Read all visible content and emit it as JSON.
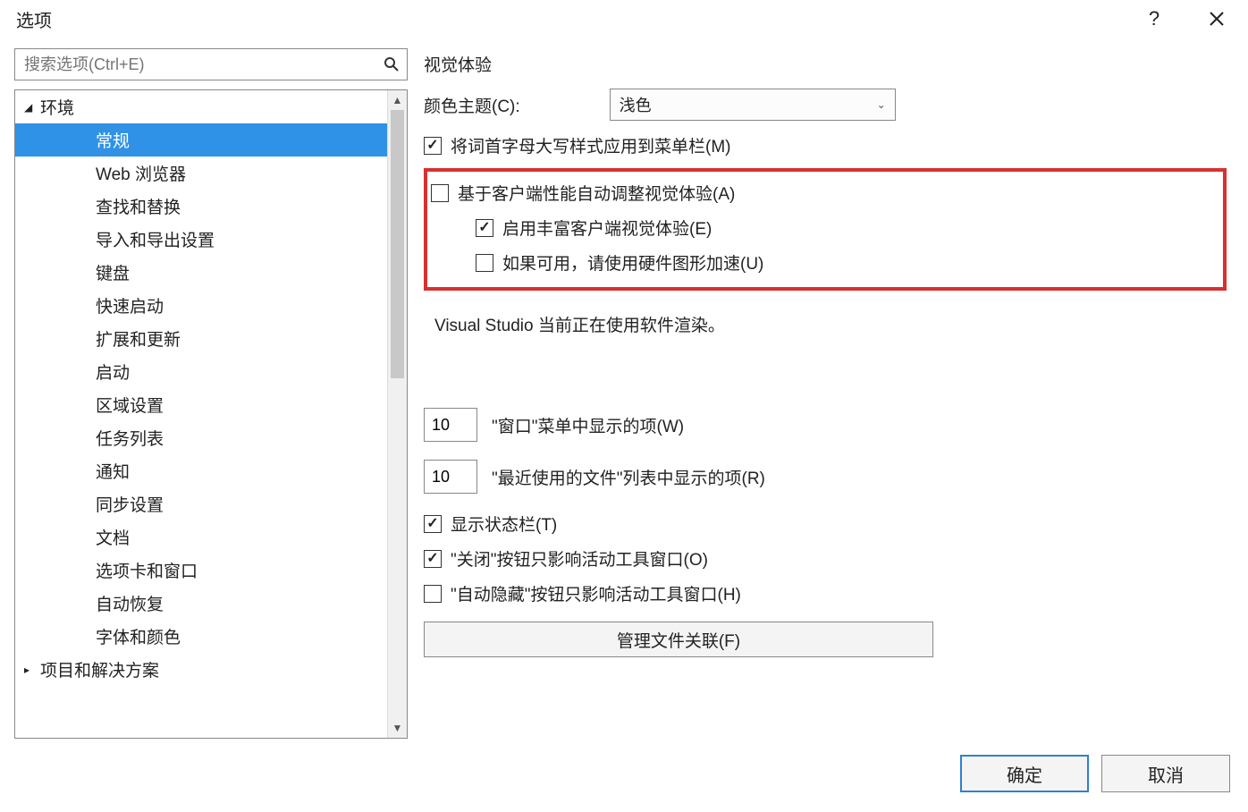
{
  "titlebar": {
    "title": "选项"
  },
  "search": {
    "placeholder": "搜索选项(Ctrl+E)"
  },
  "tree": {
    "root": "环境",
    "items": [
      "常规",
      "Web 浏览器",
      "查找和替换",
      "导入和导出设置",
      "键盘",
      "快速启动",
      "扩展和更新",
      "启动",
      "区域设置",
      "任务列表",
      "通知",
      "同步设置",
      "文档",
      "选项卡和窗口",
      "自动恢复",
      "字体和颜色"
    ],
    "next_root": "项目和解决方案",
    "selected_index": 0
  },
  "visual": {
    "section": "视觉体验",
    "theme_label": "颜色主题(C):",
    "theme_value": "浅色",
    "titlecase": "将词首字母大写样式应用到菜单栏(M)",
    "auto_adjust": "基于客户端性能自动调整视觉体验(A)",
    "rich_client": "启用丰富客户端视觉体验(E)",
    "hw_accel": "如果可用，请使用硬件图形加速(U)",
    "status": "Visual Studio 当前正在使用软件渲染。"
  },
  "window_items": {
    "value": "10",
    "label": "\"窗口\"菜单中显示的项(W)"
  },
  "mru_items": {
    "value": "10",
    "label": "\"最近使用的文件\"列表中显示的项(R)"
  },
  "checkboxes": {
    "status_bar": "显示状态栏(T)",
    "close_active": "\"关闭\"按钮只影响活动工具窗口(O)",
    "autohide_active": "\"自动隐藏\"按钮只影响活动工具窗口(H)"
  },
  "manage_button": "管理文件关联(F)",
  "footer": {
    "ok": "确定",
    "cancel": "取消"
  }
}
